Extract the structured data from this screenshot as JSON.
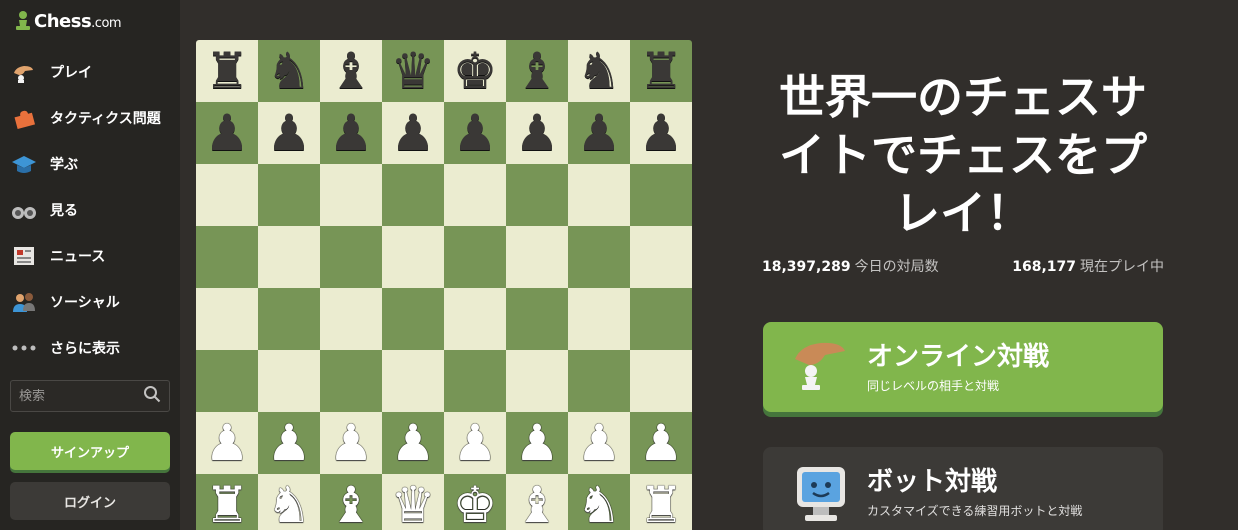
{
  "sidebar": {
    "logo_text": "Chess",
    "logo_suffix": ".com",
    "items": [
      {
        "label": "プレイ",
        "icon": "hand-pawn-icon"
      },
      {
        "label": "タクティクス問題",
        "icon": "puzzle-icon"
      },
      {
        "label": "学ぶ",
        "icon": "graduation-cap-icon"
      },
      {
        "label": "見る",
        "icon": "binoculars-icon"
      },
      {
        "label": "ニュース",
        "icon": "newspaper-icon"
      },
      {
        "label": "ソーシャル",
        "icon": "people-icon"
      },
      {
        "label": "さらに表示",
        "icon": "more-dots-icon"
      }
    ],
    "search_placeholder": "検索",
    "signup_label": "サインアップ",
    "login_label": "ログイン"
  },
  "board": {
    "ranks": [
      [
        "♜",
        "♞",
        "♝",
        "♛",
        "♚",
        "♝",
        "♞",
        "♜"
      ],
      [
        "♟",
        "♟",
        "♟",
        "♟",
        "♟",
        "♟",
        "♟",
        "♟"
      ],
      [
        "",
        "",
        "",
        "",
        "",
        "",
        "",
        ""
      ],
      [
        "",
        "",
        "",
        "",
        "",
        "",
        "",
        ""
      ],
      [
        "",
        "",
        "",
        "",
        "",
        "",
        "",
        ""
      ],
      [
        "",
        "",
        "",
        "",
        "",
        "",
        "",
        ""
      ],
      [
        "♟",
        "♟",
        "♟",
        "♟",
        "♟",
        "♟",
        "♟",
        "♟"
      ],
      [
        "♜",
        "♞",
        "♝",
        "♛",
        "♚",
        "♝",
        "♞",
        "♜"
      ]
    ],
    "colors": {
      "light": "#ebecd0",
      "dark": "#779556"
    }
  },
  "hero": {
    "title": "世界一のチェスサイトでチェスをプレイ！"
  },
  "stats": {
    "games_today_num": "18,397,289",
    "games_today_label": "今日の対局数",
    "playing_now_num": "168,177",
    "playing_now_label": "現在プレイ中"
  },
  "cta": {
    "online_title": "オンライン対戦",
    "online_sub": "同じレベルの相手と対戦",
    "bot_title": "ボット対戦",
    "bot_sub": "カスタマイズできる練習用ボットと対戦"
  },
  "accent": "#81b64c"
}
